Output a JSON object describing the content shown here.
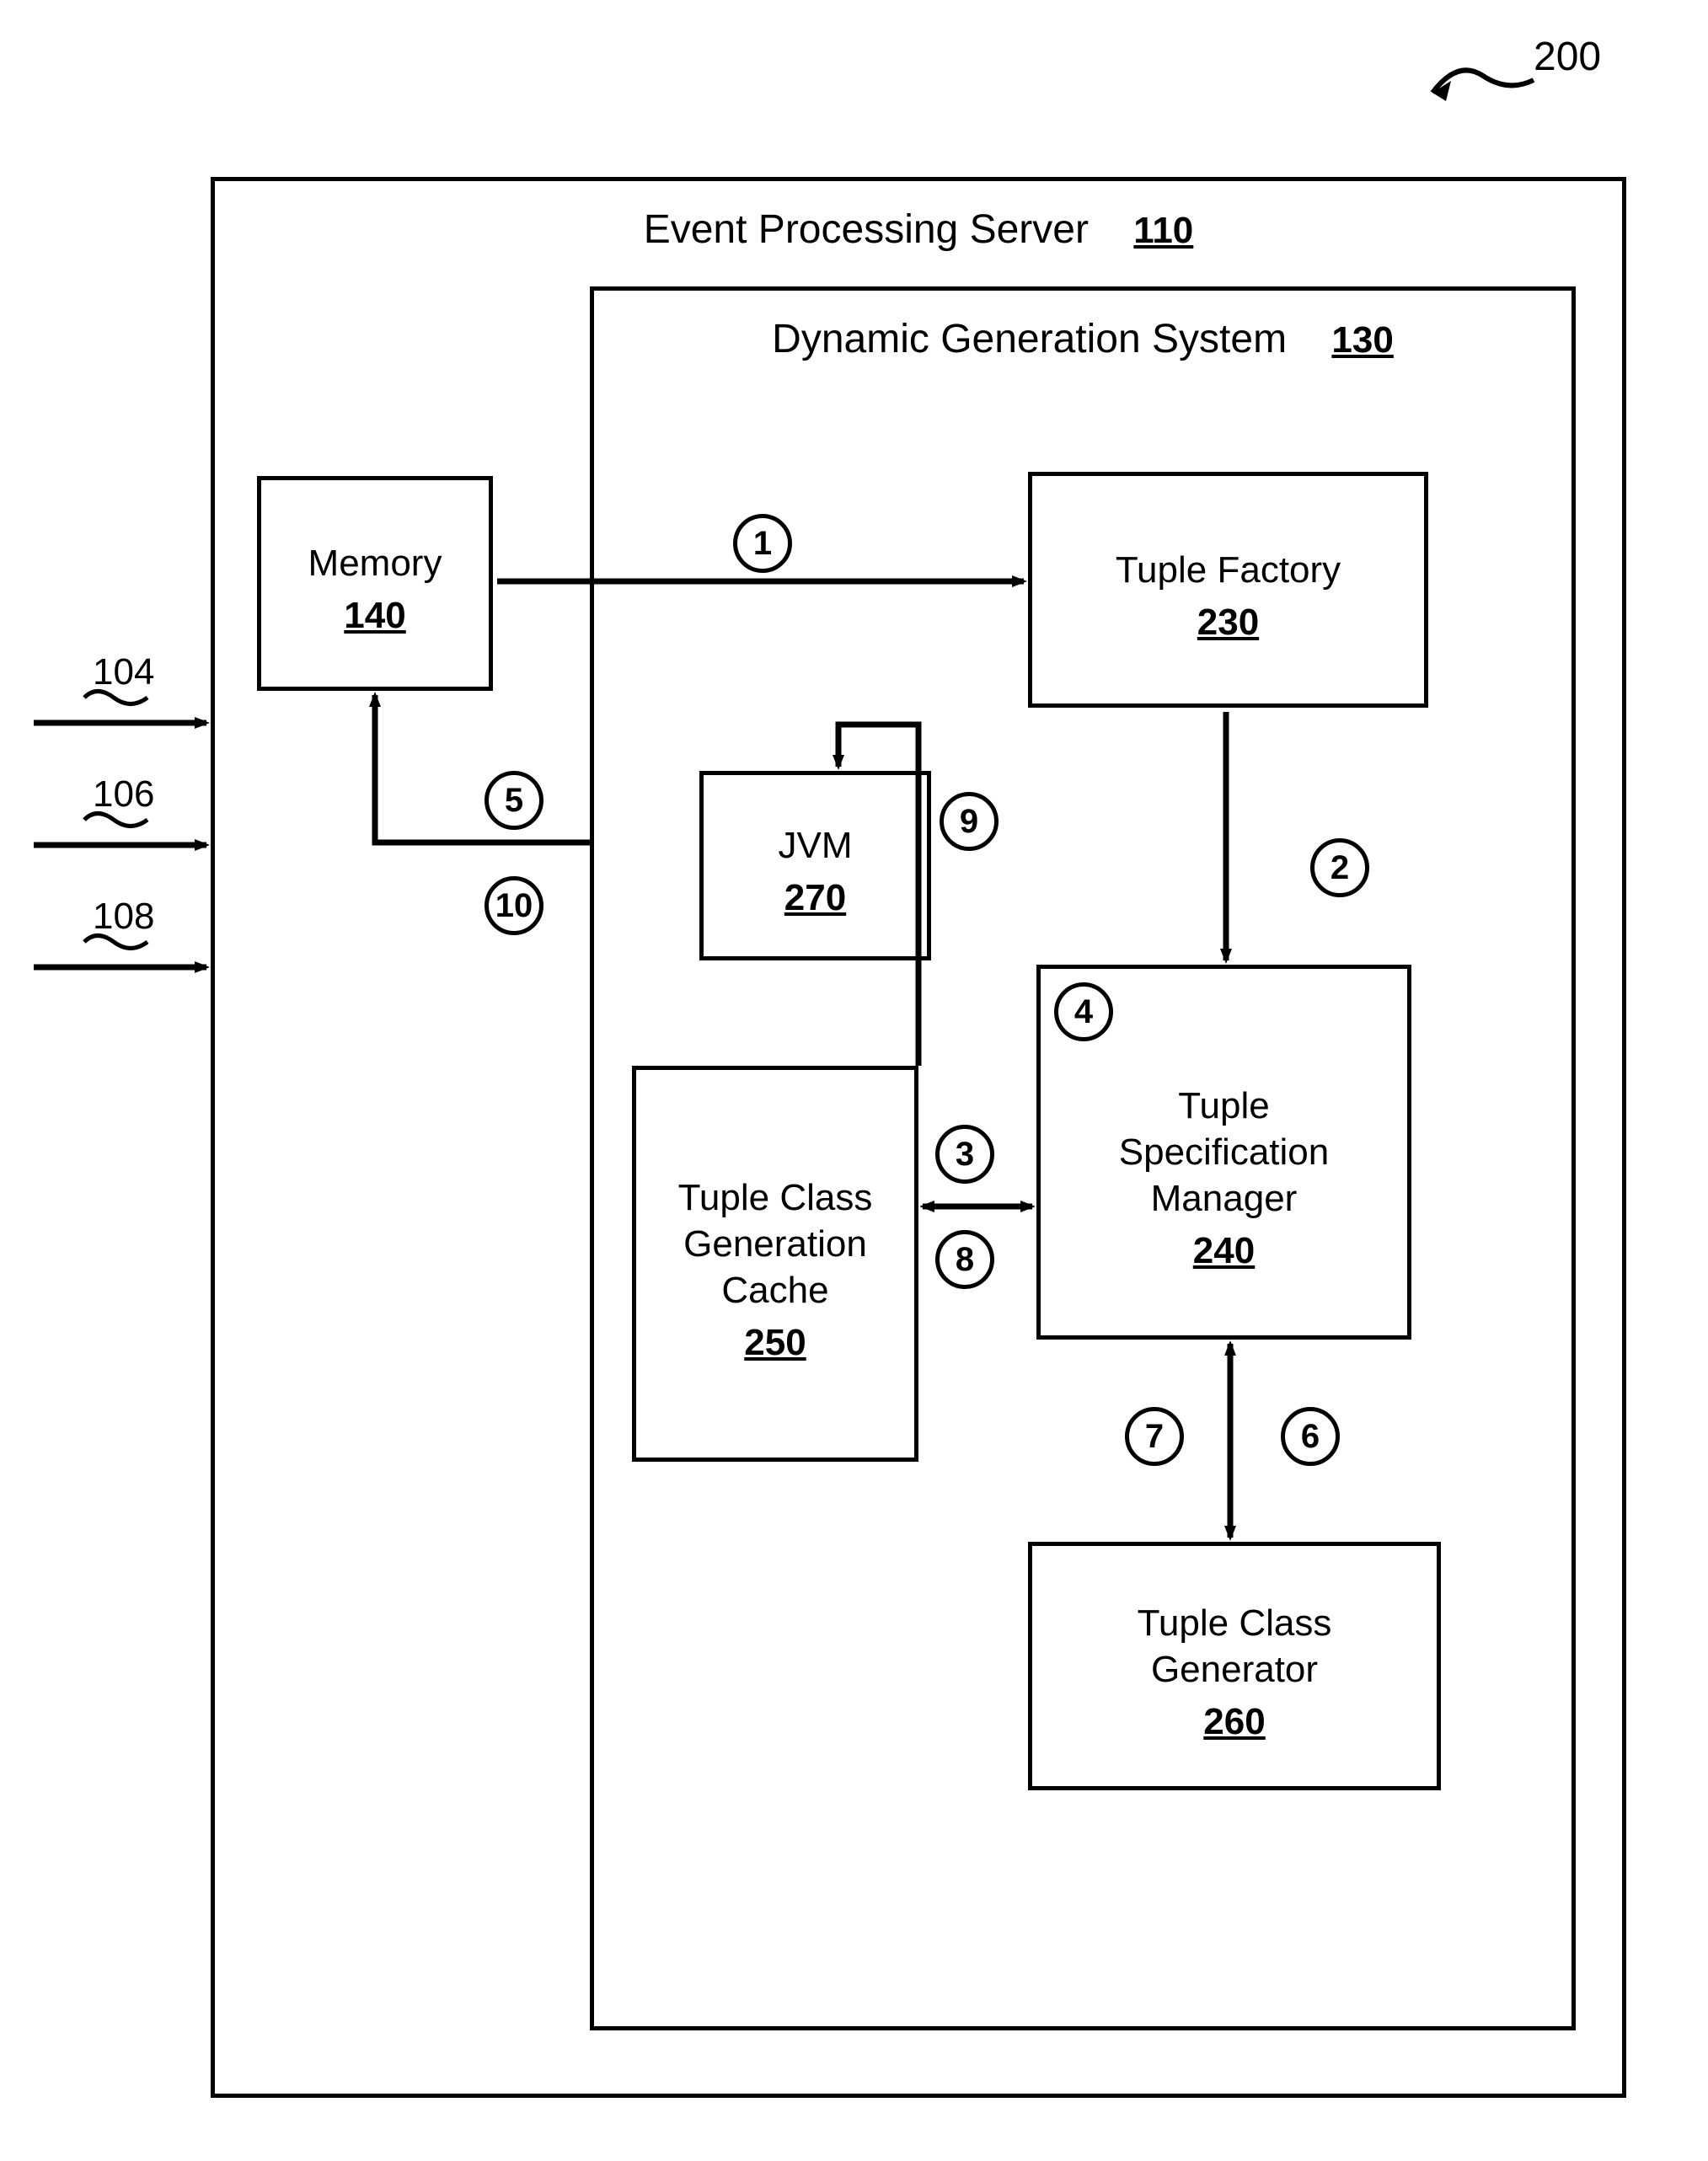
{
  "figure_ref": "200",
  "outer_box": {
    "title": "Event Processing Server",
    "ref": "110"
  },
  "inner_box": {
    "title": "Dynamic Generation System",
    "ref": "130"
  },
  "memory": {
    "title": "Memory",
    "ref": "140"
  },
  "tuple_factory": {
    "title": "Tuple Factory",
    "ref": "230"
  },
  "tuple_spec_mgr": {
    "title": "Tuple Specification Manager",
    "ref": "240"
  },
  "cache": {
    "title": "Tuple Class Generation Cache",
    "ref": "250"
  },
  "generator": {
    "title": "Tuple Class Generator",
    "ref": "260"
  },
  "jvm": {
    "title": "JVM",
    "ref": "270"
  },
  "inputs": {
    "a": "104",
    "b": "106",
    "c": "108"
  },
  "steps": {
    "s1": "1",
    "s2": "2",
    "s3": "3",
    "s4": "4",
    "s5": "5",
    "s6": "6",
    "s7": "7",
    "s8": "8",
    "s9": "9",
    "s10": "10"
  }
}
